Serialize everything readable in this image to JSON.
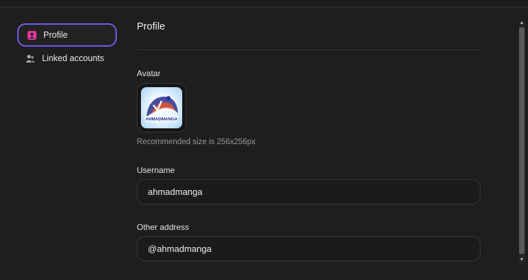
{
  "sidebar": {
    "items": [
      {
        "label": "Profile",
        "icon": "profile-icon",
        "active": true
      },
      {
        "label": "Linked accounts",
        "icon": "users-icon",
        "active": false
      }
    ]
  },
  "main": {
    "title": "Profile",
    "avatar": {
      "label": "Avatar",
      "hint": "Recommended size is 256x256px",
      "image_text": "AHMADMANGA"
    },
    "username": {
      "label": "Username",
      "value": "ahmadmanga"
    },
    "other_address": {
      "label": "Other address",
      "value": "@ahmadmanga"
    }
  },
  "colors": {
    "background": "#1e1e1f",
    "accent_border": "#6b5df0",
    "profile_icon": "#e0359f"
  }
}
